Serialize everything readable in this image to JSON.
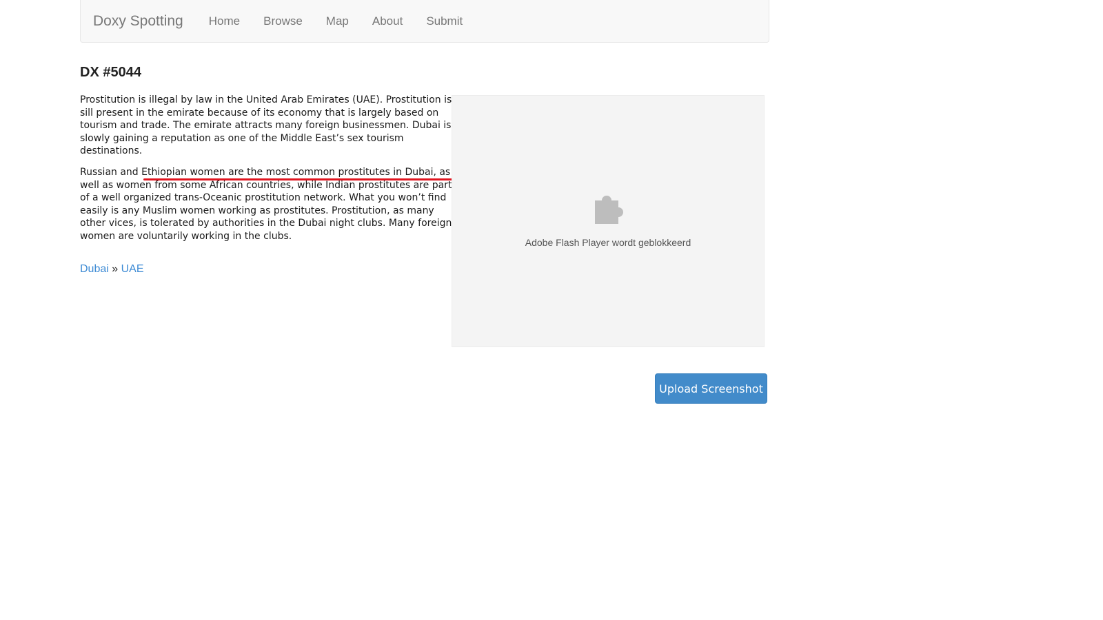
{
  "navbar": {
    "brand": "Doxy Spotting",
    "links": [
      "Home",
      "Browse",
      "Map",
      "About",
      "Submit"
    ]
  },
  "page": {
    "title": "DX #5044"
  },
  "description": {
    "paragraph1": "Prostitution is illegal by law in the United Arab Emirates (UAE). Prostitution is sill present in the emirate because of its economy that is largely based on tourism and trade. The emirate attracts many foreign businessmen. Dubai is slowly gaining a reputation as one of the Middle East’s sex tourism destinations.",
    "paragraph2_start": "Russian and ",
    "paragraph2_highlight": "Ethiopian women are the most common prostitutes in Dubai,",
    "paragraph2_end": " as well as women from some African countries, while Indian prostitutes are part of a well organized trans-Oceanic prostitution network. What you won’t find easily is any Muslim women working as prostitutes. Prostitution, as many other vices, is tolerated by authorities in the Dubai night clubs. Many foreign women are voluntarily working in the clubs."
  },
  "location": {
    "city": "Dubai",
    "separator": " » ",
    "country": "UAE"
  },
  "flash": {
    "icon": "puzzle-piece-icon",
    "message": "Adobe Flash Player wordt geblokkeerd"
  },
  "actions": {
    "upload_label": "Upload Screenshot"
  },
  "colors": {
    "link": "#3c8ad4",
    "button": "#428bca",
    "highlight_underline": "#e0141e"
  }
}
